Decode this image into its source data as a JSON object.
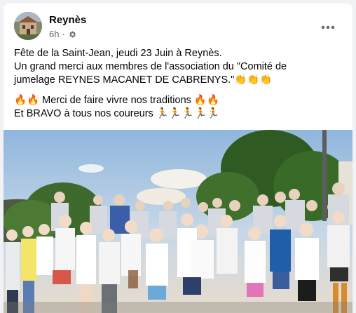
{
  "post": {
    "author": "Reynès",
    "time": "6h",
    "separator": "·",
    "privacy_icon": "settings-gear-icon",
    "more_icon": "more-horizontal-icon",
    "paragraph1": [
      "Fête de la Saint-Jean, jeudi 23 Juin à Reynès.",
      "Un grand merci aux membres de l'association du  \"Comité de",
      "jumelage REYNES MACANET DE CABRENYS.\"👏👏👏"
    ],
    "paragraph2": [
      "🔥🔥 Merci de faire vivre nos traditions 🔥🔥",
      "Et BRAVO à tous nos coureurs 🏃🏃🏃🏃🏃"
    ]
  },
  "colors": {
    "background": "#f0f2f5",
    "card": "#ffffff",
    "text": "#050505",
    "secondary_text": "#65676b"
  }
}
